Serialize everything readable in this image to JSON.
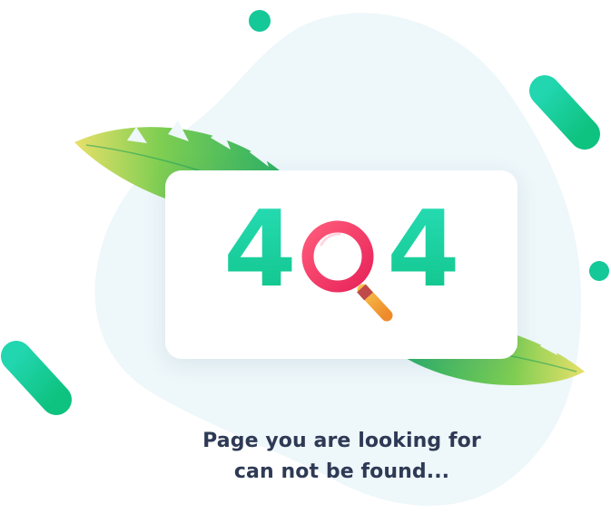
{
  "error": {
    "digit_first": "4",
    "digit_last": "4",
    "message_line1": "Page you are looking for",
    "message_line2": "can not be found..."
  },
  "icons": {
    "center_glyph": "magnifier-icon",
    "decorations": [
      "leaf-icon",
      "dot-icon",
      "pill-icon"
    ]
  },
  "colors": {
    "accent_green": "#10c48a",
    "accent_teal": "#27dcb4",
    "magnifier_red": "#f03a6a",
    "text_dark": "#2e3a55",
    "blob_bg": "#eef7fa"
  }
}
